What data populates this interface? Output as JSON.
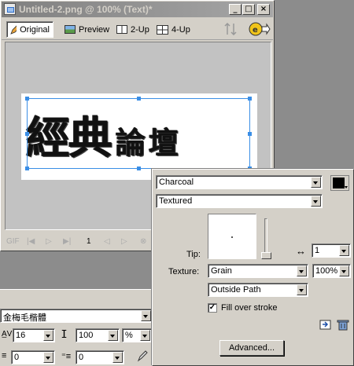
{
  "document": {
    "title": "Untitled-2.png @ 100% (Text)*",
    "window_buttons": {
      "minimize": "_",
      "restore": "□",
      "close": "×"
    },
    "tabs": [
      {
        "label": "Original",
        "icon": "pencil-icon",
        "selected": true
      },
      {
        "label": "Preview",
        "icon": "image-icon",
        "selected": false
      },
      {
        "label": "2-Up",
        "icon": "2up-icon",
        "selected": false
      },
      {
        "label": "4-Up",
        "icon": "4up-icon",
        "selected": false
      }
    ],
    "canvas_text_big": "經典",
    "canvas_text_small": "論壇",
    "frame_controls": {
      "format": "GIF",
      "frame_number": "1"
    }
  },
  "properties": {
    "font_name": "金梅毛楷體",
    "font_size": "16",
    "leading": "100",
    "leading_unit": "%",
    "indent": "0",
    "space_before": "0"
  },
  "brush_panel": {
    "stroke_category": "Charcoal",
    "stroke_name": "Textured",
    "stroke_color": "#000000",
    "tip_label": "Tip:",
    "tip_size": "1",
    "texture_label": "Texture:",
    "texture_value": "Grain",
    "texture_amount": "100%",
    "placement": "Outside Path",
    "fill_over_stroke_label": "Fill over stroke",
    "fill_over_stroke_checked": true,
    "advanced_button": "Advanced..."
  },
  "colors": {
    "selection": "#3a8ee6",
    "chrome": "#d4d0c8",
    "workspace": "#8c8c8c"
  }
}
